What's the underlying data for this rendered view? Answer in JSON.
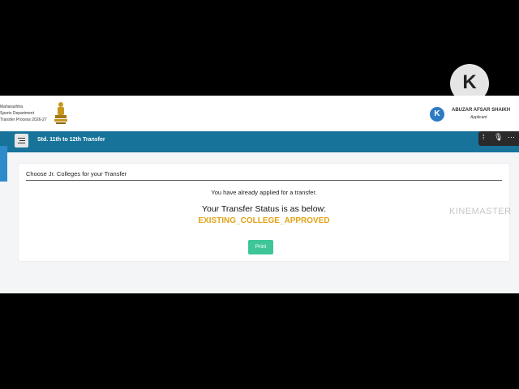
{
  "header": {
    "org_line1": "Maharashtra",
    "org_line2": "Sports Department",
    "org_line3": "Transfer Process 2026-27",
    "user_avatar": "K",
    "user_name": "ABUZAR AFSAR SHAIKH",
    "user_role": "Applicant"
  },
  "navbar": {
    "title": "Std. 11th to 12th Transfer",
    "color": "#17739a"
  },
  "card": {
    "title": "Choose Jr. Colleges for your Transfer",
    "message": "You have already applied for a transfer.",
    "status_title": "Your Transfer Status is as below:",
    "status_value": "EXISTING_COLLEGE_APPROVED",
    "status_color": "#e0a317",
    "print_label": "Print",
    "print_color": "#3fc698"
  },
  "watermark": {
    "logo_letter": "K",
    "text": "KINEMASTER"
  },
  "video_controls": {
    "icons": [
      "drag-handle-icon",
      "microphone-icon",
      "more-icon"
    ]
  }
}
